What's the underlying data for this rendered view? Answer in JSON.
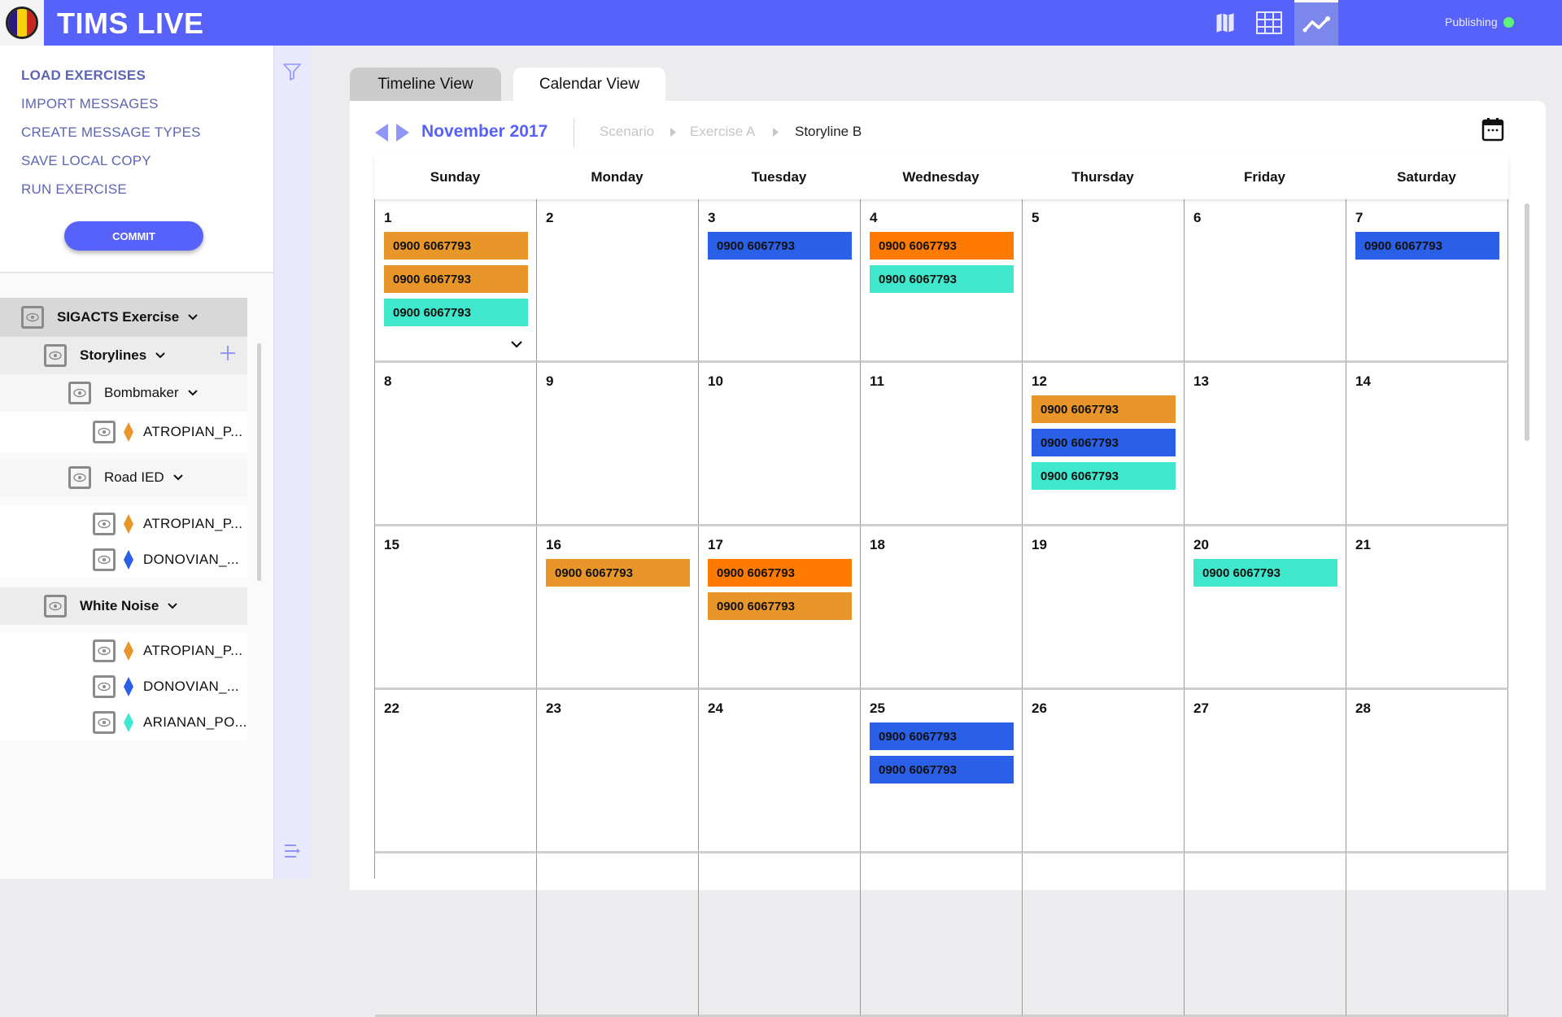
{
  "app": {
    "title": "TIMS LIVE",
    "logo": "unit-crest-logo",
    "top_icons": [
      {
        "name": "map-icon",
        "active": false
      },
      {
        "name": "table-grid-icon",
        "active": false
      },
      {
        "name": "line-chart-icon",
        "active": true
      }
    ],
    "status": {
      "label": "Publishing",
      "color": "#5ef37a"
    }
  },
  "sidebar": {
    "menu": [
      {
        "label": "LOAD EXERCISES",
        "bold": true
      },
      {
        "label": "IMPORT MESSAGES",
        "bold": false
      },
      {
        "label": "CREATE MESSAGE TYPES",
        "bold": false
      },
      {
        "label": "SAVE LOCAL COPY",
        "bold": false
      },
      {
        "label": "RUN EXERCISE",
        "bold": false
      }
    ],
    "commit_label": "COMMIT",
    "tree": {
      "root": "SIGACTS Exercise",
      "storylines_label": "Storylines",
      "groups": [
        {
          "label": "Bombmaker",
          "items": [
            {
              "label": "ATROPIAN_P...",
              "color": "#e8962a"
            }
          ]
        },
        {
          "label": "Road IED",
          "items": [
            {
              "label": "ATROPIAN_P...",
              "color": "#e8962a"
            },
            {
              "label": "DONOVIAN_...",
              "color": "#2a5fe8"
            }
          ]
        },
        {
          "label": "White Noise",
          "items": [
            {
              "label": "ATROPIAN_P...",
              "color": "#e8962a"
            },
            {
              "label": "DONOVIAN_...",
              "color": "#2a5fe8"
            },
            {
              "label": "ARIANAN_PO...",
              "color": "#3fe8cc"
            }
          ]
        }
      ]
    }
  },
  "tabs": [
    {
      "label": "Timeline View",
      "active": false
    },
    {
      "label": "Calendar View",
      "active": true
    }
  ],
  "calendar": {
    "month_label": "November 2017",
    "breadcrumb": [
      "Scenario",
      "Exercise A",
      "Storyline B"
    ],
    "weekdays": [
      "Sunday",
      "Monday",
      "Tuesday",
      "Wednesday",
      "Thursday",
      "Friday",
      "Saturday"
    ],
    "colors": {
      "amber": "#e8962a",
      "orange": "#ff7a00",
      "blue": "#2a5fe8",
      "teal": "#3fe8cc"
    },
    "weeks": [
      [
        {
          "day": "1",
          "events": [
            {
              "label": "0900 6067793",
              "color": "amber"
            },
            {
              "label": "0900 6067793",
              "color": "amber"
            },
            {
              "label": "0900 6067793",
              "color": "teal"
            }
          ],
          "more": true
        },
        {
          "day": "2",
          "events": []
        },
        {
          "day": "3",
          "events": [
            {
              "label": "0900 6067793",
              "color": "blue"
            }
          ]
        },
        {
          "day": "4",
          "events": [
            {
              "label": "0900 6067793",
              "color": "orange"
            },
            {
              "label": "0900 6067793",
              "color": "teal"
            }
          ]
        },
        {
          "day": "5",
          "events": []
        },
        {
          "day": "6",
          "events": []
        },
        {
          "day": "7",
          "events": [
            {
              "label": "0900 6067793",
              "color": "blue"
            }
          ]
        }
      ],
      [
        {
          "day": "8",
          "events": []
        },
        {
          "day": "9",
          "events": []
        },
        {
          "day": "10",
          "events": []
        },
        {
          "day": "11",
          "events": []
        },
        {
          "day": "12",
          "events": [
            {
              "label": "0900 6067793",
              "color": "amber"
            },
            {
              "label": "0900 6067793",
              "color": "blue"
            },
            {
              "label": "0900 6067793",
              "color": "teal"
            }
          ]
        },
        {
          "day": "13",
          "events": []
        },
        {
          "day": "14",
          "events": []
        }
      ],
      [
        {
          "day": "15",
          "events": []
        },
        {
          "day": "16",
          "events": [
            {
              "label": "0900 6067793",
              "color": "amber"
            }
          ]
        },
        {
          "day": "17",
          "events": [
            {
              "label": "0900 6067793",
              "color": "orange"
            },
            {
              "label": "0900 6067793",
              "color": "amber"
            }
          ]
        },
        {
          "day": "18",
          "events": []
        },
        {
          "day": "19",
          "events": []
        },
        {
          "day": "20",
          "events": [
            {
              "label": "0900 6067793",
              "color": "teal"
            }
          ]
        },
        {
          "day": "21",
          "events": []
        }
      ],
      [
        {
          "day": "22",
          "events": []
        },
        {
          "day": "23",
          "events": []
        },
        {
          "day": "24",
          "events": []
        },
        {
          "day": "25",
          "events": [
            {
              "label": "0900 6067793",
              "color": "blue"
            },
            {
              "label": "0900 6067793",
              "color": "blue"
            }
          ]
        },
        {
          "day": "26",
          "events": []
        },
        {
          "day": "27",
          "events": []
        },
        {
          "day": "28",
          "events": []
        }
      ],
      [
        {
          "day": "",
          "events": []
        },
        {
          "day": "",
          "events": []
        },
        {
          "day": "",
          "events": []
        },
        {
          "day": "",
          "events": []
        },
        {
          "day": "",
          "events": []
        },
        {
          "day": "",
          "events": []
        },
        {
          "day": "",
          "events": []
        }
      ]
    ]
  }
}
